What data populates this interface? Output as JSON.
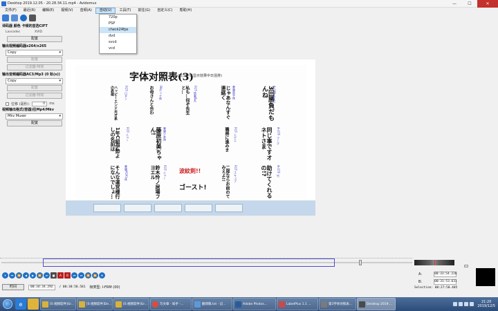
{
  "window": {
    "title": "Desktop 2019.12.05 - 20.28.34.11.mp4 - Avidemux"
  },
  "window_buttons": {
    "minimize": "—",
    "maximize": "☐",
    "close": "✕"
  },
  "menu": [
    "文件(F)",
    "最近(R)",
    "编辑(E)",
    "视频(V)",
    "音频(A)",
    "自动(U)",
    "工具(T)",
    "前往(G)",
    "自定义(C)",
    "帮助(H)"
  ],
  "auto_menu_items": [
    "720p",
    "PSP",
    "check24fps",
    "dvd",
    "svcd",
    "vcd"
  ],
  "left_panel": {
    "decode_title": "译码器 颜色 卡顿的首选CIFT",
    "decoder_label": "Lavcodec",
    "decoder_value": "XVID",
    "config": "配置",
    "video_output_title": "输出视频编码器x264/x265",
    "video_codec": "Copy",
    "video_config": "配置",
    "video_filters": "过滤器-特效",
    "audio_output_title": "输出音频编码器AC3/Mp3 (0 轨(s))",
    "audio_codec": "Copy",
    "audio_config": "配置",
    "audio_filters": "过滤器-特效",
    "shift_label": "位移 (毫秒):",
    "shift_value": "0",
    "shift_unit": "ms",
    "format_title": "视频输出格式(容器)往Mp4/Mkv",
    "format_value": "Mkv Muxer",
    "format_config": "配置"
  },
  "preview": {
    "doc_title": "字体对照表(3)",
    "doc_subtitle": "(日文字体显示效果中日混排)",
    "columns_top": [
      {
        "text": "3回勝負だもんね",
        "cap": "A-OTF 新丸ゴ"
      },
      {
        "text": "じゃあなんすぐ連絡く",
        "cap": "華康英字体"
      },
      {
        "text": "私も…何ぞ先生と…",
        "cap": "FOT-筑紫B丸"
      },
      {
        "text": "お母さんと合わ",
        "cap": "FAボッテ体"
      },
      {
        "text": "ハッピーエンド天才系の表現",
        "cap": "FOT-ロダン"
      }
    ],
    "columns_mid": [
      {
        "text": "同じ事ですオネトさま",
        "cap": "A-OTF フーク"
      },
      {
        "text": "職務に進みま",
        "cap": "FOT-レゲエ"
      },
      {
        "text": "藤原初美ちゃん!",
        "cap": "華康少女体"
      },
      {
        "text": "1年C組伊勢よしの名前は",
        "cap": "FOT-ニュー"
      }
    ],
    "columns_bottom": [
      {
        "text": "助けてくれるの!?",
        "cap": "A-OTF 竹"
      },
      {
        "text": "二部ならお前のてみえよ!!",
        "cap": "FOT-スキップ"
      },
      {
        "text": "鈴木怜ノ居場フヨエル",
        "cap": "FOT-ニュー"
      },
      {
        "text": "そんな運営様行にないでしょ…",
        "cap": "華康POP1体"
      }
    ],
    "stamps": [
      "波紋剣!!",
      "ゴースト!"
    ]
  },
  "controls": [
    "⏵",
    "⏮",
    "⏪",
    "◀",
    "▶",
    "⏩",
    "⏭",
    "■",
    "A",
    "B",
    "⏮",
    "⏭",
    "⏪",
    "⏩",
    "⏺"
  ],
  "status": {
    "time_button": "时间",
    "current_time": "00:34:34.292",
    "total_time": "/ 00:38:58.581",
    "frame_type": "帧类型: I-FRM (00)"
  },
  "ab": {
    "a_label": "A:",
    "a_value": "00:33:54.226",
    "b_label": "B:",
    "b_value": "00:31:53.631",
    "selection": "Selection: 00:27:58.405"
  },
  "taskbar": {
    "items": [
      {
        "label": "[0.视频软件]Gr...",
        "color": "#d8b23a"
      },
      {
        "label": "[0.视频软件]De...",
        "color": "#d8b23a"
      },
      {
        "label": "[0.视频软件]Gr...",
        "color": "#d8b23a"
      },
      {
        "label": "写文章 - 知乎 -...",
        "color": "#e04a3a"
      },
      {
        "label": "翻译稿.txt - 记...",
        "color": "#5a9ad8"
      },
      {
        "label": "Adobe Photos...",
        "color": "#2a5c9a"
      },
      {
        "label": "LabelPlus 1.1 ...",
        "color": "#c94a4a"
      },
      {
        "label": "第3字体对照表...",
        "color": "#7a7a7a"
      },
      {
        "label": "Desktop 2019....",
        "color": "#4a4a4a"
      }
    ],
    "clock_time": "21:20",
    "clock_date": "2019/12/5"
  },
  "colors": {
    "selection_border": "#4b4bd0",
    "accent_blue": "#1e6fc4",
    "menu_highlight": "#cce4f7"
  }
}
